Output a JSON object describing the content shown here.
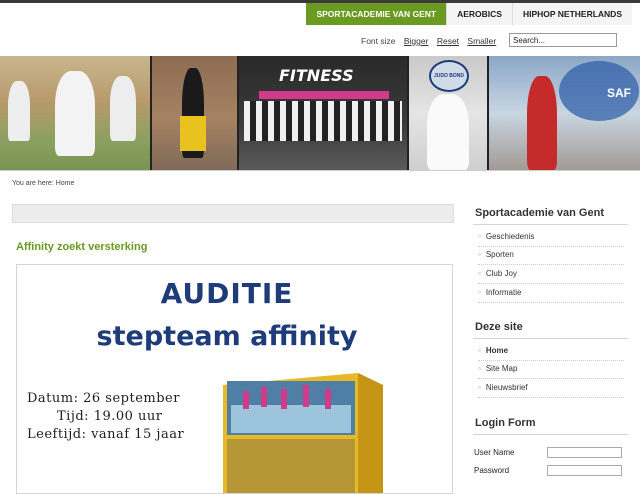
{
  "nav": {
    "items": [
      "SPORTACADEMIE VAN GENT",
      "AEROBICS",
      "HIPHOP NETHERLANDS"
    ]
  },
  "fontsize": {
    "label": "Font size",
    "bigger": "Bigger",
    "reset": "Reset",
    "smaller": "Smaller"
  },
  "search": {
    "value": "Search..."
  },
  "banner": {
    "fitness_text": "FITNESS",
    "badge_text": "JUDO BOND",
    "sport_logo_text": "SAF",
    "colors": {
      "fitness_pink": "#d23a8c",
      "judo_green": "#7a9450"
    }
  },
  "breadcrumb": "You are here: Home",
  "article": {
    "title": "Affinity zoekt versterking",
    "poster": {
      "line1": "AUDITIE",
      "line2": "stepteam affinity",
      "datum": "Datum: 26 september",
      "tijd": "Tijd: 19.00 uur",
      "leeftijd": "Leeftijd: vanaf 15 jaar",
      "title_color": "#1f3c7a"
    }
  },
  "sidebar": {
    "section1": {
      "title": "Sportacademie van Gent",
      "items": [
        "Geschiedenis",
        "Sporten",
        "Club Joy",
        "Informatie"
      ]
    },
    "section2": {
      "title": "Deze site",
      "items": [
        "Home",
        "Site Map",
        "Nieuwsbrief"
      ]
    },
    "login": {
      "title": "Login Form",
      "user_label": "User Name",
      "pass_label": "Password"
    }
  },
  "accent_color": "#6a9a22"
}
